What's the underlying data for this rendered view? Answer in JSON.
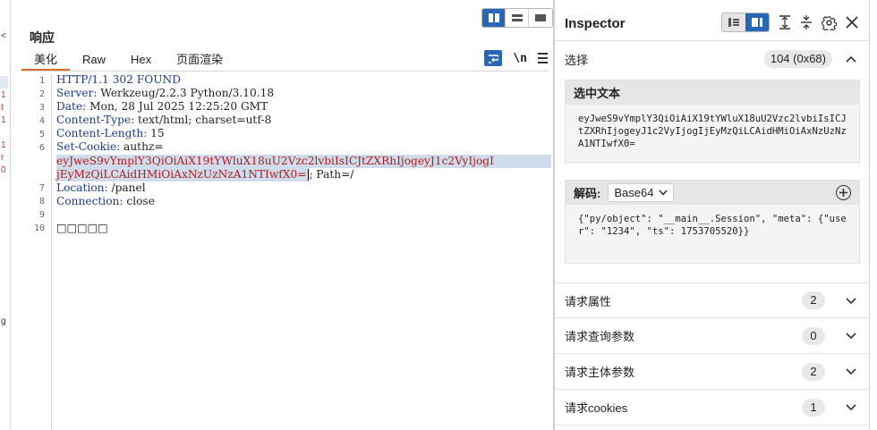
{
  "left_strip": {
    "marks": [
      "<",
      "1",
      "t",
      "1",
      "1",
      "r",
      "0",
      "g"
    ]
  },
  "response": {
    "title": "响应",
    "tabs": [
      "美化",
      "Raw",
      "Hex",
      "页面渲染"
    ],
    "active_tab": 0,
    "newline_toggle": "\\n",
    "line_numbers": [
      "1",
      "2",
      "3",
      "4",
      "5",
      "6",
      "7",
      "8",
      "9",
      "10"
    ],
    "lines": {
      "l1": "HTTP/1.1 302 FOUND",
      "l2_key": "Server:",
      "l2_val": " Werkzeug/2.2.3 Python/3.10.18",
      "l3_key": "Date:",
      "l3_val": " Mon, 28 Jul 2025 12:25:20 GMT",
      "l4_key": "Content-Type:",
      "l4_val": " text/html; charset=utf-8",
      "l5_key": "Content-Length:",
      "l5_val": " 15",
      "l6_key": "Set-Cookie:",
      "l6_val": " authz=",
      "l6_cookie_a": "eyJweS9vYmplY3QiOiAiX19tYWluX18uU2Vzc2lvbiIsICJtZXRhIjogeyJ1c2VyIjogI",
      "l6_cookie_b": "jEyMzQiLCAidHMiOiAxNzUzNzA1NTIwfX0=",
      "l6_rest": "; Path=/",
      "l7_key": "Location:",
      "l7_val": " /panel",
      "l8_key": "Connection:",
      "l8_val": " close",
      "l10": "□□□□□"
    }
  },
  "inspector": {
    "title": "Inspector",
    "selection": {
      "label": "选择",
      "value": "104 (0x68)"
    },
    "selected_text": {
      "header": "选中文本",
      "content": "eyJweS9vYmplY3QiOiAiX19tYWluX18uU2Vzc2lvbiIsICJtZXRhIjogeyJ1c2VyIjogIjEyMzQiLCAidHMiOiAxNzUzNzA1NTIwfX0="
    },
    "decode": {
      "label": "解码:",
      "encoding": "Base64",
      "content": "{\"py/object\": \"__main__.Session\", \"meta\": {\"user\": \"1234\", \"ts\": 1753705520}}"
    },
    "sections": [
      {
        "label": "请求属性",
        "count": "2"
      },
      {
        "label": "请求查询参数",
        "count": "0"
      },
      {
        "label": "请求主体参数",
        "count": "2"
      },
      {
        "label": "请求cookies",
        "count": "1"
      }
    ]
  },
  "colors": {
    "accent": "#2a66b6",
    "tab_underline": "#e36b29",
    "header_key": "#1e3a8a",
    "cookie_value": "#b01d1d",
    "selection": "#cfdcec"
  }
}
